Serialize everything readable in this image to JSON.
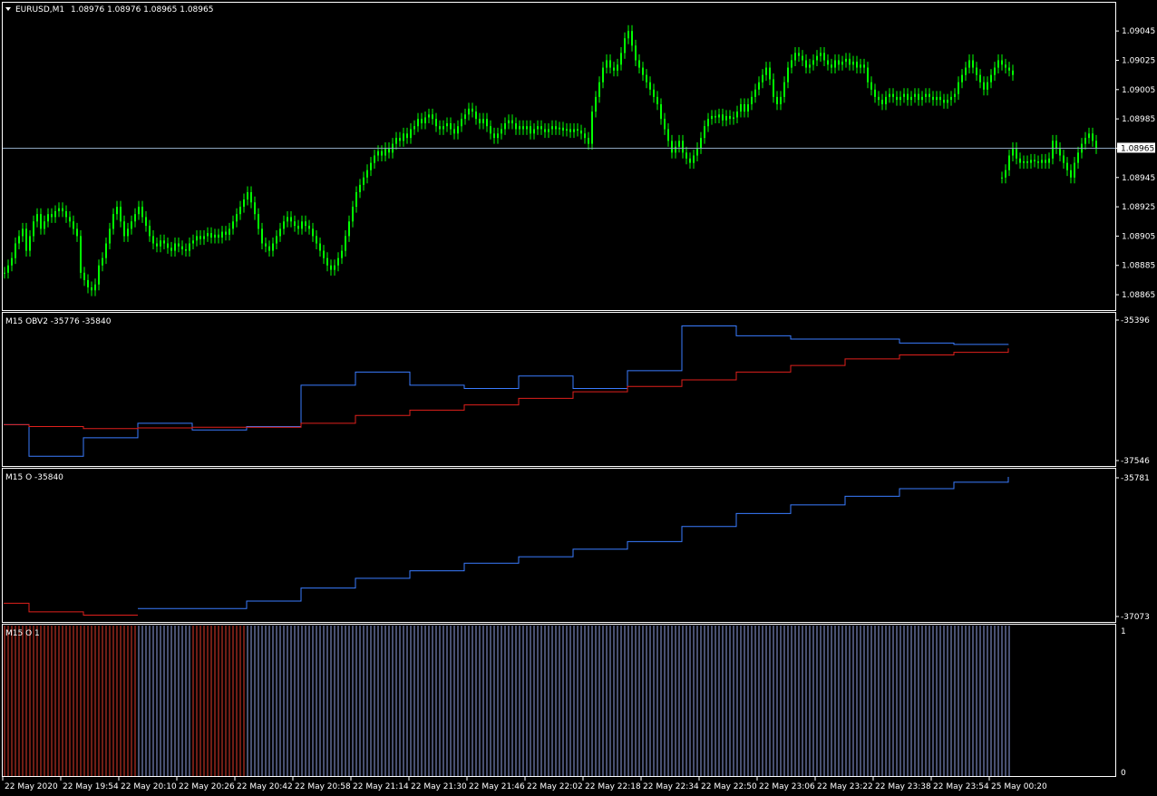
{
  "window": {
    "symbol_label": "EURUSD,M1",
    "ohlc": "1.08976 1.08976 1.08965 1.08965",
    "current_price": "1.08965",
    "menu_icon": "triangle-down-icon"
  },
  "colors": {
    "background": "#000000",
    "frame": "#ffffff",
    "candles": "#00ff00",
    "price_line": "#8ea6bf",
    "blue_line": "#3a7cff",
    "red_line": "#e0201c",
    "hist_blue": "#8fa0e0",
    "hist_red": "#e03a2a"
  },
  "chart_data": [
    {
      "type": "candlestick",
      "name": "EURUSD,M1",
      "y_ticks": [
        "1.09045",
        "1.09025",
        "1.09005",
        "1.08985",
        "1.08965",
        "1.08945",
        "1.08925",
        "1.08905",
        "1.08885",
        "1.08865"
      ],
      "ylim": [
        1.08857,
        1.09055
      ],
      "current_price": 1.08965,
      "closes": [
        1.0888,
        1.08885,
        1.0889,
        1.089,
        1.08905,
        1.0891,
        1.08895,
        1.08905,
        1.08915,
        1.0892,
        1.0891,
        1.08915,
        1.0892,
        1.08918,
        1.08922,
        1.08924,
        1.08922,
        1.08918,
        1.08915,
        1.0891,
        1.08905,
        1.0888,
        1.08875,
        1.0887,
        1.08868,
        1.08872,
        1.08885,
        1.0889,
        1.089,
        1.0891,
        1.0892,
        1.08925,
        1.08915,
        1.08905,
        1.0891,
        1.08915,
        1.0892,
        1.08925,
        1.08918,
        1.08912,
        1.08905,
        1.089,
        1.08898,
        1.08902,
        1.089,
        1.08897,
        1.08895,
        1.089,
        1.08898,
        1.08896,
        1.08895,
        1.089,
        1.08902,
        1.08905,
        1.08903,
        1.08905,
        1.08907,
        1.08904,
        1.08906,
        1.08904,
        1.08908,
        1.08906,
        1.0891,
        1.08915,
        1.0892,
        1.08925,
        1.0893,
        1.08935,
        1.08928,
        1.0892,
        1.0891,
        1.089,
        1.08898,
        1.08895,
        1.089,
        1.08905,
        1.0891,
        1.08915,
        1.08918,
        1.08915,
        1.08912,
        1.0891,
        1.08915,
        1.08912,
        1.0891,
        1.08905,
        1.089,
        1.08895,
        1.0889,
        1.08885,
        1.08882,
        1.08885,
        1.0889,
        1.08895,
        1.08905,
        1.08915,
        1.08925,
        1.08935,
        1.0894,
        1.08945,
        1.0895,
        1.08955,
        1.0896,
        1.08963,
        1.0896,
        1.08965,
        1.08962,
        1.08968,
        1.08972,
        1.0897,
        1.08975,
        1.08972,
        1.08978,
        1.0898,
        1.08985,
        1.08982,
        1.08986,
        1.08988,
        1.08985,
        1.0898,
        1.08978,
        1.0898,
        1.08982,
        1.08978,
        1.08975,
        1.0898,
        1.08985,
        1.08988,
        1.08992,
        1.0899,
        1.08985,
        1.08982,
        1.08985,
        1.0898,
        1.08975,
        1.08972,
        1.08975,
        1.08978,
        1.08982,
        1.08984,
        1.08982,
        1.08978,
        1.0898,
        1.08978,
        1.0898,
        1.08975,
        1.08978,
        1.0898,
        1.08978,
        1.08976,
        1.08978,
        1.0898,
        1.08978,
        1.08979,
        1.08977,
        1.08978,
        1.08976,
        1.08978,
        1.08977,
        1.08975,
        1.08972,
        1.08968,
        1.0899,
        1.09,
        1.0901,
        1.0902,
        1.09025,
        1.0902,
        1.09018,
        1.09022,
        1.0903,
        1.0904,
        1.09045,
        1.09035,
        1.09025,
        1.0902,
        1.09015,
        1.0901,
        1.09005,
        1.09,
        1.08995,
        1.08985,
        1.08978,
        1.0897,
        1.08962,
        1.08966,
        1.0897,
        1.08962,
        1.08958,
        1.08955,
        1.0896,
        1.08965,
        1.08972,
        1.0898,
        1.08985,
        1.08987,
        1.08986,
        1.08988,
        1.08984,
        1.08987,
        1.08985,
        1.08986,
        1.0899,
        1.08995,
        1.0899,
        1.08995,
        1.09,
        1.09005,
        1.0901,
        1.09015,
        1.0902,
        1.09012,
        1.09,
        1.08995,
        1.09,
        1.0901,
        1.0902,
        1.09025,
        1.0903,
        1.09028,
        1.09025,
        1.0902,
        1.09022,
        1.09025,
        1.09028,
        1.0903,
        1.09025,
        1.09022,
        1.0902,
        1.09025,
        1.09022,
        1.09024,
        1.09026,
        1.09022,
        1.09024,
        1.0902,
        1.09022,
        1.0902,
        1.0901,
        1.09005,
        1.09,
        1.08998,
        1.08995,
        1.09,
        1.09002,
        1.09,
        1.08998,
        1.09,
        1.09002,
        1.08998,
        1.09,
        1.09002,
        1.08998,
        1.09,
        1.09002,
        1.09,
        1.08998,
        1.09,
        1.08998,
        1.08996,
        1.08998,
        1.09,
        1.09002,
        1.0901,
        1.09015,
        1.0902,
        1.09025,
        1.0902,
        1.09015,
        1.0901,
        1.09005,
        1.0901,
        1.09015,
        1.0902,
        1.09025,
        1.09022,
        1.0902,
        1.09018,
        1.09015
      ],
      "highs_offset": 4e-05,
      "gap_after_index": 273,
      "tail_candles": [
        1.08945,
        1.0895,
        1.0896,
        1.08965,
        1.08958,
        1.08955,
        1.08956,
        1.08955,
        1.08957,
        1.08956,
        1.08955,
        1.08957,
        1.08955,
        1.08958,
        1.0897,
        1.08965,
        1.0896,
        1.08955,
        1.0895,
        1.08945,
        1.08955,
        1.08962,
        1.08968,
        1.08972,
        1.08975,
        1.0897,
        1.08965
      ]
    },
    {
      "type": "line",
      "label": "M15 OBV2 -35776 -35840",
      "y_ticks": [
        "-35396",
        "-37546"
      ],
      "ylim": [
        -37546,
        -35396
      ],
      "series": [
        {
          "color_key": "blue_line",
          "steps": [
            [
              0,
              -37000
            ],
            [
              7,
              -37480
            ],
            [
              22,
              -37200
            ],
            [
              37,
              -36980
            ],
            [
              52,
              -37080
            ],
            [
              67,
              -37030
            ],
            [
              82,
              -36400
            ],
            [
              97,
              -36200
            ],
            [
              112,
              -36400
            ],
            [
              127,
              -36450
            ],
            [
              142,
              -36260
            ],
            [
              157,
              -36450
            ],
            [
              172,
              -36180
            ],
            [
              187,
              -35500
            ],
            [
              202,
              -35650
            ],
            [
              217,
              -35700
            ],
            [
              232,
              -35700
            ],
            [
              247,
              -35760
            ],
            [
              262,
              -35780
            ],
            [
              277,
              -35776
            ]
          ]
        },
        {
          "color_key": "red_line",
          "steps": [
            [
              0,
              -37000
            ],
            [
              7,
              -37030
            ],
            [
              22,
              -37060
            ],
            [
              37,
              -37050
            ],
            [
              52,
              -37040
            ],
            [
              67,
              -37040
            ],
            [
              82,
              -36980
            ],
            [
              97,
              -36860
            ],
            [
              112,
              -36780
            ],
            [
              127,
              -36700
            ],
            [
              142,
              -36600
            ],
            [
              157,
              -36500
            ],
            [
              172,
              -36420
            ],
            [
              187,
              -36320
            ],
            [
              202,
              -36200
            ],
            [
              217,
              -36100
            ],
            [
              232,
              -36000
            ],
            [
              247,
              -35940
            ],
            [
              262,
              -35900
            ],
            [
              277,
              -35840
            ]
          ]
        }
      ]
    },
    {
      "type": "line",
      "label": "M15 O -35840",
      "y_ticks": [
        "-35781",
        "-37073"
      ],
      "ylim": [
        -37073,
        -35781
      ],
      "series": [
        {
          "color_key": "blue_line",
          "steps": [
            [
              37,
              -37000
            ],
            [
              67,
              -36930
            ],
            [
              82,
              -36810
            ],
            [
              97,
              -36720
            ],
            [
              112,
              -36650
            ],
            [
              127,
              -36580
            ],
            [
              142,
              -36520
            ],
            [
              157,
              -36450
            ],
            [
              172,
              -36380
            ],
            [
              187,
              -36240
            ],
            [
              202,
              -36120
            ],
            [
              217,
              -36040
            ],
            [
              232,
              -35960
            ],
            [
              247,
              -35890
            ],
            [
              262,
              -35830
            ],
            [
              277,
              -35781
            ]
          ]
        },
        {
          "color_key": "red_line",
          "steps": [
            [
              0,
              -36950
            ],
            [
              7,
              -37030
            ],
            [
              22,
              -37060
            ],
            [
              37,
              -37060
            ]
          ]
        }
      ]
    },
    {
      "type": "histogram",
      "label": "M15 O 1",
      "y_ticks": [
        "1",
        "0"
      ],
      "ylim": [
        0,
        1
      ],
      "segments": [
        {
          "from": 0,
          "to": 37,
          "value": 1,
          "color_key": "hist_red"
        },
        {
          "from": 37,
          "to": 52,
          "value": 1,
          "color_key": "hist_blue"
        },
        {
          "from": 52,
          "to": 67,
          "value": 1,
          "color_key": "hist_red"
        },
        {
          "from": 67,
          "to": 278,
          "value": 1,
          "color_key": "hist_blue"
        }
      ]
    }
  ],
  "time_axis": {
    "labels": [
      "22 May 2020",
      "22 May 19:54",
      "22 May 20:10",
      "22 May 20:26",
      "22 May 20:42",
      "22 May 20:58",
      "22 May 21:14",
      "22 May 21:30",
      "22 May 21:46",
      "22 May 22:02",
      "22 May 22:18",
      "22 May 22:34",
      "22 May 22:50",
      "22 May 23:06",
      "22 May 23:22",
      "22 May 23:38",
      "22 May 23:54",
      "25 May 00:20"
    ]
  }
}
